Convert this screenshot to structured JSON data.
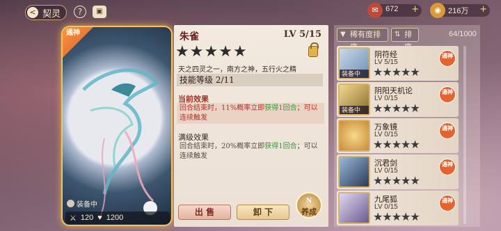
{
  "topbar": {
    "back_label": "契灵",
    "back_icon": "<",
    "help_label": "?",
    "chat_icon": "▣",
    "resources": [
      {
        "name": "ticket",
        "icon": "✉",
        "value": "672",
        "color": "#c04a3a"
      },
      {
        "name": "gold",
        "icon": "◉",
        "value": "216万",
        "color": "#d89a3a"
      }
    ],
    "plus": "+"
  },
  "card": {
    "badge": "通神",
    "equip_label": "装备中",
    "attack_icon": "⚔",
    "attack": "120",
    "health_icon": "♥",
    "health": "1200"
  },
  "detail": {
    "name": "朱雀",
    "level": "LV 5/15",
    "stars": [
      "★",
      "★",
      "★",
      "★",
      "★"
    ],
    "description": "天之四灵之一，南方之神，五行火之精",
    "skill_level": "技能等级 2/11",
    "current_title": "当前效果",
    "current_pre": "回合结束时，11%概率立即",
    "current_hl": "获得1回合",
    "current_post": "；可以连续触发",
    "max_title": "满级效果",
    "max_pre": "回合结束时，20%概率立即",
    "max_hl": "获得1回合",
    "max_post": "；可以连续触发",
    "sell": "出 售",
    "unequip": "卸 下",
    "nurture_sub": "N",
    "nurture": "养成"
  },
  "list": {
    "sort_rarity": "稀有度排序",
    "sort_order": "排序",
    "count": "64/1000",
    "items": [
      {
        "name": "阴符经",
        "level": "LV 5/15",
        "stars": "★★★★★",
        "equipped": "装备中",
        "badge": "通神",
        "color": "#6b8fb3"
      },
      {
        "name": "阴阳天机论",
        "level": "LV 0/15",
        "stars": "★★★★★",
        "equipped": "装备中",
        "badge": "通神",
        "color": "#8a6a2a"
      },
      {
        "name": "万象镜",
        "level": "LV 0/15",
        "stars": "★★★★★",
        "equipped": "",
        "badge": "通神",
        "color": "#c98a3a"
      },
      {
        "name": "沉君剑",
        "level": "LV 0/15",
        "stars": "★★★★★",
        "equipped": "",
        "badge": "通神",
        "color": "#4a6a9a"
      },
      {
        "name": "九尾狐",
        "level": "LV 0/15",
        "stars": "★★★★★",
        "equipped": "",
        "badge": "通神",
        "color": "#8a7ab0"
      }
    ]
  }
}
